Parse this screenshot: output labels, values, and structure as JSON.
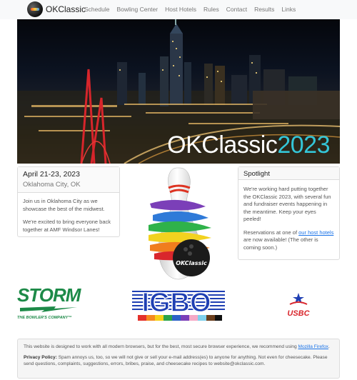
{
  "nav": {
    "brand": "OKClassic",
    "links": [
      "Schedule",
      "Bowling Center",
      "Host Hotels",
      "Rules",
      "Contact",
      "Results",
      "Links"
    ]
  },
  "hero": {
    "title_word": "OKClassic",
    "title_year": "2023",
    "year_color": "#34c6d8"
  },
  "event": {
    "date": "April 21-23, 2023",
    "location": "Oklahoma City, OK",
    "paragraphs": [
      "Join us in Oklahoma City as we showcase the best of the midwest.",
      "We're excited to bring everyone back together at AMF Windsor Lanes!"
    ]
  },
  "spotlight": {
    "title": "Spotlight",
    "paragraph1": "We're working hard putting together the OKClassic 2023, with several fun and fundraiser events happening in the meantime. Keep your eyes peeled!",
    "p2_before": "Reservations at one of ",
    "p2_link": "our host hotels",
    "p2_after": " are now available! (The other is coming soon.)"
  },
  "pin": {
    "icon": "bowling-pin-logo-icon",
    "ball_text": "OKClassic"
  },
  "sponsors": {
    "storm": {
      "word": "STORM",
      "tagline": "THE BOWLER'S COMPANY™",
      "color": "#1d8a48"
    },
    "igbo": {
      "word": "IGBO",
      "color": "#1f3fb3"
    },
    "usbc": {
      "word": "USBC"
    }
  },
  "footer": {
    "compat_text": "This website is designed to work with all modern browsers, but for the best, most secure browser experience, we recommend using ",
    "compat_link": "Mozilla Firefox",
    "compat_end": ".",
    "privacy_label": "Privacy Policy:",
    "privacy_text": " Spam annoys us, too, so we will not give or sell your e-mail address(es) to anyone for anything. Not even for cheesecake. Please send questions, complaints, suggestions, errors, bribes, praise, and cheesecake recipes to website@okclassic.com."
  }
}
